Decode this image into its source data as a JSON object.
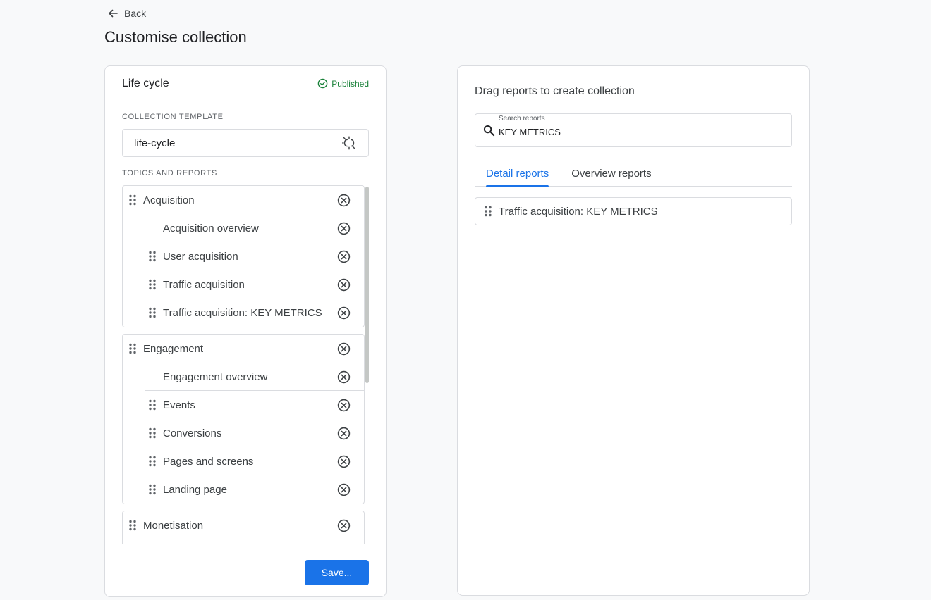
{
  "header": {
    "back_label": "Back",
    "page_title": "Customise collection"
  },
  "left_panel": {
    "title": "Life cycle",
    "status": "Published",
    "collection_template_label": "COLLECTION TEMPLATE",
    "template_value": "life-cycle",
    "topics_label": "TOPICS AND REPORTS",
    "topics": [
      {
        "name": "Acquisition",
        "overview": "Acquisition overview",
        "reports": [
          "User acquisition",
          "Traffic acquisition",
          "Traffic acquisition: KEY METRICS"
        ]
      },
      {
        "name": "Engagement",
        "overview": "Engagement overview",
        "reports": [
          "Events",
          "Conversions",
          "Pages and screens",
          "Landing page"
        ]
      },
      {
        "name": "Monetisation"
      }
    ],
    "save_label": "Save..."
  },
  "right_panel": {
    "title": "Drag reports to create collection",
    "search_label": "Search reports",
    "search_value": "KEY METRICS",
    "tabs": [
      "Detail reports",
      "Overview reports"
    ],
    "active_tab": "Detail reports",
    "results": [
      "Traffic acquisition: KEY METRICS"
    ]
  },
  "colors": {
    "accent": "#1a73e8",
    "published": "#188038",
    "border": "#dadce0"
  }
}
